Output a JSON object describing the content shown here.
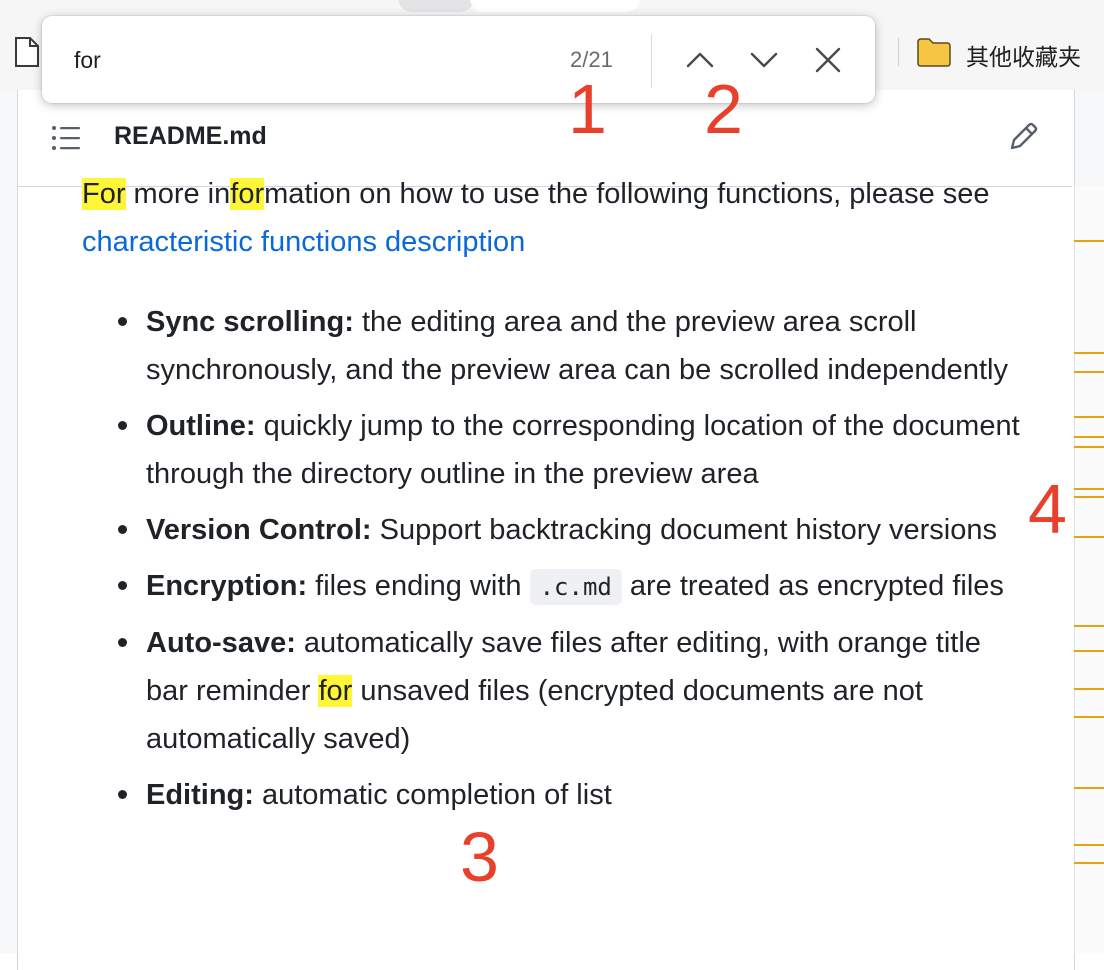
{
  "browser": {
    "bookmarks_folder_label": "其他收藏夹"
  },
  "find_bar": {
    "query": "for",
    "match_count": "2/21",
    "icons": {
      "previous": "chevron-up-icon",
      "next": "chevron-down-icon",
      "close": "close-icon"
    }
  },
  "file": {
    "name": "README.md",
    "icons": {
      "outline": "list-icon",
      "edit": "pencil-icon"
    }
  },
  "content": {
    "intro": {
      "w1": "For",
      "w2": " more in",
      "w3": "for",
      "w4": "mation on how to use the following functions, please see ",
      "link": "characteristic functions description"
    },
    "features": [
      {
        "term": "Sync scrolling:",
        "text": " the editing area and the preview area scroll synchronously, and the preview area can be scrolled independently"
      },
      {
        "term": "Outline:",
        "text": " quickly jump to the corresponding location of the document through the directory outline in the preview area"
      },
      {
        "term": "Version Control:",
        "text": " Support backtracking document history versions"
      },
      {
        "term": "Encryption:",
        "text_before": " files ending with ",
        "code": ".c.md",
        "text_after": " are treated as encrypted files"
      },
      {
        "term": "Auto-save:",
        "text_before": " automatically save files after editing, with orange title bar reminder ",
        "highlight": "for",
        "text_after": " unsaved files (encrypted documents are not automatically saved)"
      },
      {
        "term": "Editing:",
        "text": " automatic completion of list"
      }
    ]
  },
  "annotations": {
    "a1": "1",
    "a2": "2",
    "a3": "3",
    "a4": "4"
  },
  "colors": {
    "highlight": "#fff638",
    "link": "#0969da",
    "annotation": "#e8402a",
    "scroll_marker": "#e5a50a"
  }
}
